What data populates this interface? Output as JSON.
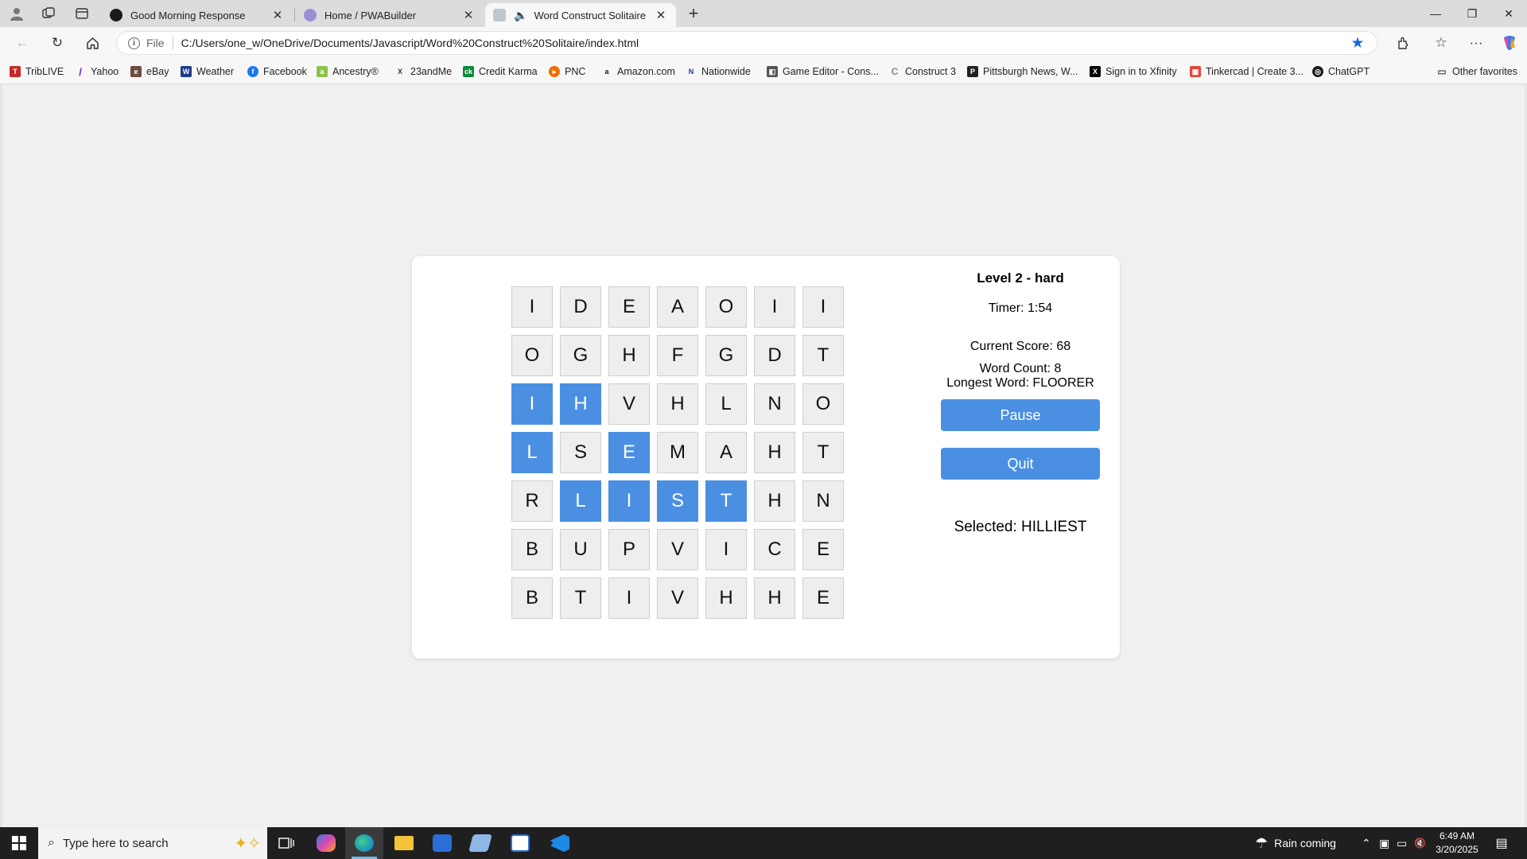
{
  "browser": {
    "tabs": [
      {
        "title": "Good Morning Response",
        "active": false
      },
      {
        "title": "Home / PWABuilder",
        "active": false
      },
      {
        "title": "Word Construct Solitaire",
        "active": true
      }
    ],
    "address": {
      "scheme_label": "File",
      "url": "C:/Users/one_w/OneDrive/Documents/Javascript/Word%20Construct%20Solitaire/index.html"
    },
    "favorites": [
      "TribLIVE",
      "Yahoo",
      "eBay",
      "Weather",
      "Facebook",
      "Ancestry®",
      "23andMe",
      "Credit Karma",
      "PNC",
      "Amazon.com",
      "Nationwide",
      "Game Editor - Cons...",
      "Construct 3",
      "Pittsburgh News, W...",
      "Sign in to Xfinity",
      "Tinkercad | Create 3...",
      "ChatGPT"
    ],
    "other_favorites": "Other favorites"
  },
  "game": {
    "level": "Level 2 - hard",
    "timer": "Timer: 1:54",
    "score": "Current Score: 68",
    "word_count": "Word Count: 8",
    "longest_word": "Longest Word: FLOORER",
    "pause_label": "Pause",
    "quit_label": "Quit",
    "selected": "Selected: HILLIEST",
    "selection_color": "#4a8fe2",
    "grid": [
      [
        "I",
        "D",
        "E",
        "A",
        "O",
        "I",
        "I"
      ],
      [
        "O",
        "G",
        "H",
        "F",
        "G",
        "D",
        "T"
      ],
      [
        "I",
        "H",
        "V",
        "H",
        "L",
        "N",
        "O"
      ],
      [
        "L",
        "S",
        "E",
        "M",
        "A",
        "H",
        "T"
      ],
      [
        "R",
        "L",
        "I",
        "S",
        "T",
        "H",
        "N"
      ],
      [
        "B",
        "U",
        "P",
        "V",
        "I",
        "C",
        "E"
      ],
      [
        "B",
        "T",
        "I",
        "V",
        "H",
        "H",
        "E"
      ]
    ],
    "selected_cells": [
      [
        2,
        0
      ],
      [
        2,
        1
      ],
      [
        3,
        0
      ],
      [
        3,
        2
      ],
      [
        4,
        1
      ],
      [
        4,
        2
      ],
      [
        4,
        3
      ],
      [
        4,
        4
      ]
    ]
  },
  "taskbar": {
    "search_placeholder": "Type here to search",
    "weather": "Rain coming",
    "time": "6:49 AM",
    "date": "3/20/2025"
  }
}
